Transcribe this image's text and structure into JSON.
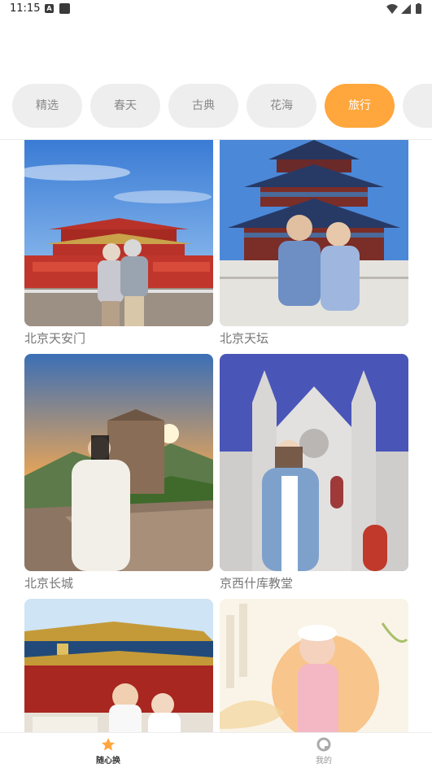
{
  "status_bar": {
    "time": "11:15",
    "notif_letter": "A"
  },
  "tabs": [
    {
      "label": "精选",
      "active": false
    },
    {
      "label": "春天",
      "active": false
    },
    {
      "label": "古典",
      "active": false
    },
    {
      "label": "花海",
      "active": false
    },
    {
      "label": "旅行",
      "active": true
    }
  ],
  "cards": [
    {
      "caption": "北京天安门"
    },
    {
      "caption": "北京天坛"
    },
    {
      "caption": "北京长城"
    },
    {
      "caption": "京西什库教堂"
    },
    {
      "caption": ""
    },
    {
      "caption": ""
    }
  ],
  "bottom_nav": {
    "home_label": "随心换",
    "mine_label": "我的"
  },
  "colors": {
    "accent": "#ffa63c",
    "tab_bg": "#eeeeee"
  }
}
